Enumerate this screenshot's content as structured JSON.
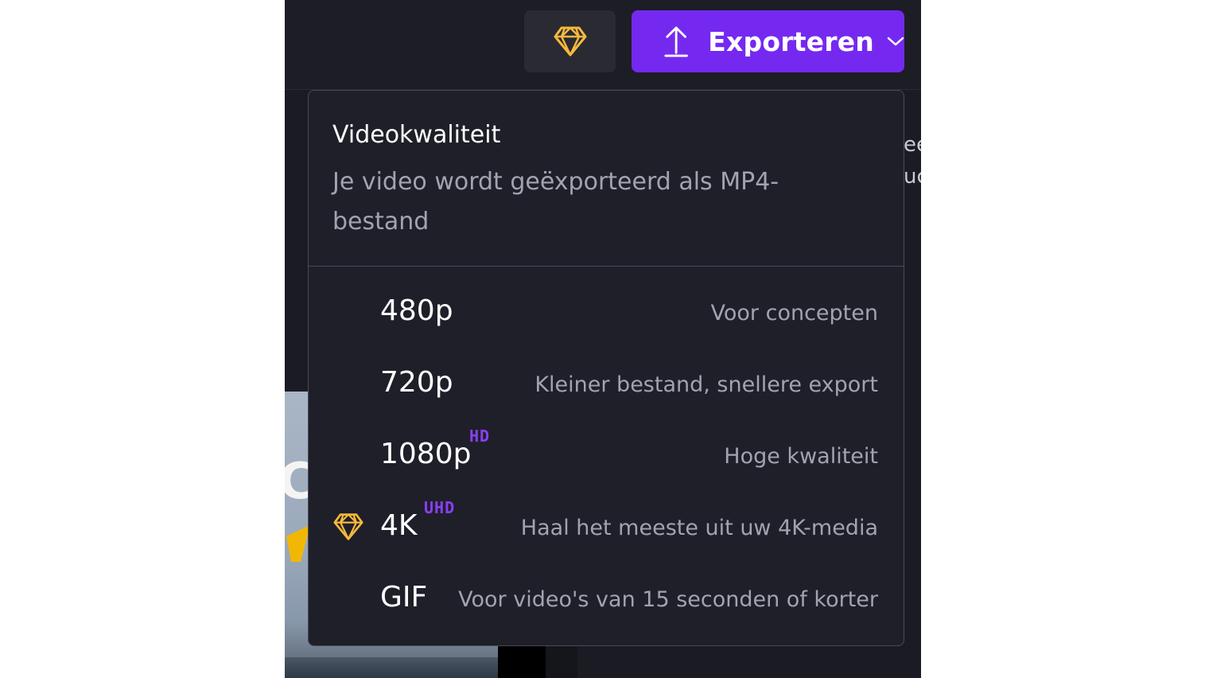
{
  "topbar": {
    "premium_icon": "diamond-icon",
    "export": {
      "label": "Exporteren",
      "icon": "upload-icon",
      "chevron_icon": "chevron-down-icon"
    }
  },
  "background": {
    "letter": "C",
    "right_text": [
      "ee",
      "uc"
    ]
  },
  "dropdown": {
    "title": "Videokwaliteit",
    "subtitle": "Je video wordt geëxporteerd als MP4-bestand",
    "options": [
      {
        "label": "480p",
        "badge": "",
        "description": "Voor concepten",
        "premium": false
      },
      {
        "label": "720p",
        "badge": "",
        "description": "Kleiner bestand, snellere export",
        "premium": false
      },
      {
        "label": "1080p",
        "badge": "HD",
        "description": "Hoge kwaliteit",
        "premium": false
      },
      {
        "label": "4K",
        "badge": "UHD",
        "description": "Haal het meeste uit uw 4K-media",
        "premium": true
      },
      {
        "label": "GIF",
        "badge": "",
        "description": "Voor video's van 15 seconden of korter",
        "premium": false
      }
    ]
  },
  "colors": {
    "accent": "#7529f0",
    "badge": "#8a3ff5",
    "premium_gold": "#f6b93b",
    "panel_bg": "#1f1f2a",
    "muted_text": "#a3a3b0"
  }
}
